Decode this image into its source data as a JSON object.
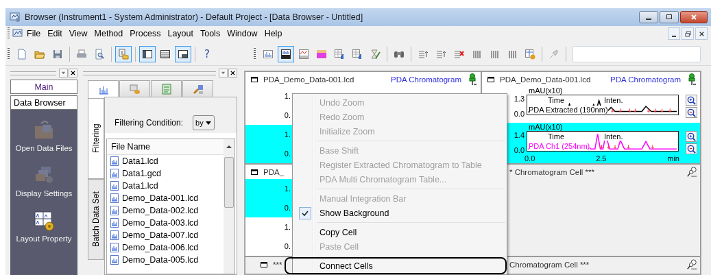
{
  "window": {
    "title": "Browser (Instrument1 - System Administrator) - Default Project - [Data Browser - Untitled]"
  },
  "menu": [
    "File",
    "Edit",
    "View",
    "Method",
    "Process",
    "Layout",
    "Tools",
    "Window",
    "Help"
  ],
  "toolbar_left": [
    {
      "kind": "new",
      "selected": false
    },
    {
      "kind": "open",
      "selected": false
    },
    {
      "kind": "save",
      "selected": false
    },
    {
      "kind": "separator"
    },
    {
      "kind": "print",
      "selected": false
    },
    {
      "kind": "preview",
      "selected": false
    },
    {
      "kind": "separator"
    },
    {
      "kind": "browser",
      "selected": true
    },
    {
      "kind": "separator"
    },
    {
      "kind": "layout-left",
      "selected": true
    },
    {
      "kind": "layout-rows",
      "selected": false
    },
    {
      "kind": "layout-corner",
      "selected": true
    },
    {
      "kind": "separator"
    }
  ],
  "help_button": "?",
  "toolbar_right": [
    {
      "kind": "chromatogram",
      "selected": false
    },
    {
      "kind": "pda-chromatogram",
      "selected": true
    },
    {
      "kind": "spectrum",
      "selected": false
    },
    {
      "kind": "contour",
      "selected": false
    },
    {
      "kind": "table",
      "selected": false
    },
    {
      "kind": "pda-table",
      "selected": false
    },
    {
      "kind": "wizard",
      "selected": false
    },
    {
      "kind": "separator"
    },
    {
      "kind": "binoculars",
      "selected": false
    },
    {
      "kind": "separator"
    },
    {
      "kind": "list-up",
      "selected": false
    },
    {
      "kind": "list-down",
      "selected": false
    },
    {
      "kind": "list-delete",
      "selected": false
    },
    {
      "kind": "bars-left",
      "selected": false
    },
    {
      "kind": "bars-right",
      "selected": false
    },
    {
      "kind": "bars-compare",
      "selected": false
    },
    {
      "kind": "table-gear",
      "selected": false
    },
    {
      "kind": "separator"
    },
    {
      "kind": "pin",
      "selected": false
    },
    {
      "kind": "separator"
    }
  ],
  "nav_panel": {
    "groups": [
      "Main",
      "Data Browser"
    ],
    "items": [
      {
        "kind": "open-data",
        "label": "Open Data Files",
        "disabled": true
      },
      {
        "kind": "display",
        "label": "Display Settings",
        "disabled": true
      },
      {
        "kind": "layout",
        "label": "Layout Property",
        "disabled": false
      }
    ]
  },
  "browser_panel": {
    "tabs": [
      {
        "kind": "chromatogram",
        "selected": true
      },
      {
        "kind": "method",
        "selected": false
      },
      {
        "kind": "report",
        "selected": false
      },
      {
        "kind": "batch",
        "selected": false
      }
    ],
    "side_tabs": [
      {
        "label": "Filtering",
        "selected": true
      },
      {
        "label": "Batch Data Set",
        "selected": false
      }
    ],
    "filter": {
      "label": "Filtering Condition:",
      "value": "by"
    },
    "file_list": {
      "column": "File Name",
      "files": [
        "Data1.lcd",
        "Data1.gcd",
        "Data1.lcd",
        "Demo_Data-001.lcd",
        "Demo_Data-002.lcd",
        "Demo_Data-003.lcd",
        "Demo_Data-007.lcd",
        "Demo_Data-006.lcd",
        "Demo_Data-005.lcd"
      ]
    }
  },
  "cells": [
    {
      "title": "PDA_Demo_Data-001.lcd",
      "type": "PDA Chromatogram",
      "pinned": true,
      "panes": [
        {
          "highlighted": false,
          "yticks": [
            "1.",
            "0."
          ]
        },
        {
          "highlighted": true,
          "yticks": [
            "1.",
            "0."
          ]
        }
      ]
    },
    {
      "title": "PDA_Demo_Data-001.lcd",
      "type": "PDA Chromatogram",
      "pinned": true,
      "panes": [
        {
          "highlighted": false,
          "ylabel": "mAU(x10)",
          "yticks": [
            "1.3",
            "0.0"
          ],
          "legend": [
            "Time",
            "Inten."
          ],
          "trace": "PDA Extracted (190nm)",
          "color": "#000000"
        },
        {
          "highlighted": true,
          "ylabel": "mAU(x10)",
          "yticks": [
            "1.4",
            "0.0"
          ],
          "legend": [
            "Time",
            "Inten."
          ],
          "trace": "PDA Ch1 (254nm)",
          "color": "#ff00ff",
          "xticks": [
            "0.0",
            "2.5",
            "min"
          ]
        }
      ]
    },
    {
      "title": "PDA_",
      "panes": [
        {
          "highlighted": true,
          "yticks": [
            "1.",
            "0."
          ]
        },
        {
          "highlighted": false,
          "yticks": [
            "1.",
            "0."
          ]
        }
      ]
    },
    {
      "title": "* Chromatogram Cell ***",
      "pinned": false
    },
    {
      "title": "***"
    },
    {
      "title": "Chromatogram Cell ***",
      "pinned": false
    }
  ],
  "context_menu": {
    "items": [
      {
        "kind": "item",
        "label": "Undo Zoom",
        "disabled": true,
        "checked": false,
        "highlighted": false
      },
      {
        "kind": "item",
        "label": "Redo Zoom",
        "disabled": true,
        "checked": false,
        "highlighted": false
      },
      {
        "kind": "item",
        "label": "Initialize Zoom",
        "disabled": true,
        "checked": false,
        "highlighted": false
      },
      {
        "kind": "separator"
      },
      {
        "kind": "item",
        "label": "Base Shift",
        "disabled": true,
        "checked": false,
        "highlighted": false
      },
      {
        "kind": "item",
        "label": "Register Extracted Chromatogram to Table",
        "disabled": true,
        "checked": false,
        "highlighted": false
      },
      {
        "kind": "item",
        "label": "PDA Multi Chromatogram Table...",
        "disabled": true,
        "checked": false,
        "highlighted": false
      },
      {
        "kind": "separator"
      },
      {
        "kind": "item",
        "label": "Manual Integration Bar",
        "disabled": true,
        "checked": false,
        "highlighted": false
      },
      {
        "kind": "item",
        "label": "Show Background",
        "disabled": false,
        "checked": true,
        "highlighted": false
      },
      {
        "kind": "separator"
      },
      {
        "kind": "item",
        "label": "Copy Cell",
        "disabled": false,
        "checked": false,
        "highlighted": false
      },
      {
        "kind": "item",
        "label": "Paste Cell",
        "disabled": true,
        "checked": false,
        "highlighted": false
      },
      {
        "kind": "separator"
      },
      {
        "kind": "item",
        "label": "Connect Cells",
        "disabled": false,
        "checked": false,
        "highlighted": true
      }
    ]
  }
}
